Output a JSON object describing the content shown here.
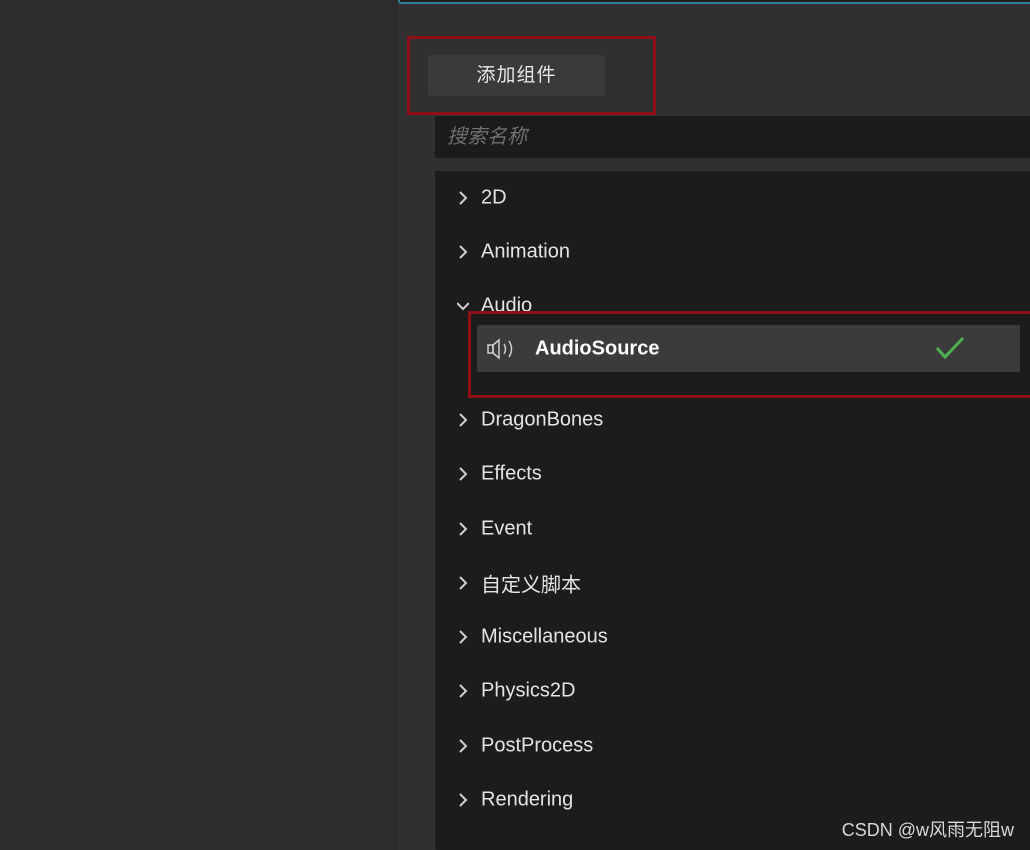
{
  "add_component": {
    "label": "添加组件"
  },
  "search": {
    "placeholder": "搜索名称",
    "value": ""
  },
  "categories": [
    {
      "label": "2D",
      "expanded": false
    },
    {
      "label": "Animation",
      "expanded": false
    },
    {
      "label": "Audio",
      "expanded": true
    },
    {
      "label": "DragonBones",
      "expanded": false
    },
    {
      "label": "Effects",
      "expanded": false
    },
    {
      "label": "Event",
      "expanded": false
    },
    {
      "label": "自定义脚本",
      "expanded": false
    },
    {
      "label": "Miscellaneous",
      "expanded": false
    },
    {
      "label": "Physics2D",
      "expanded": false
    },
    {
      "label": "PostProcess",
      "expanded": false
    },
    {
      "label": "Rendering",
      "expanded": false
    }
  ],
  "audio_items": [
    {
      "label": "AudioSource",
      "icon": "speaker-icon",
      "checked": true
    }
  ],
  "watermark": "CSDN @w风雨无阻w",
  "colors": {
    "highlight": "#8e1016",
    "check": "#4caf50",
    "accent_border": "#2f7f97"
  }
}
